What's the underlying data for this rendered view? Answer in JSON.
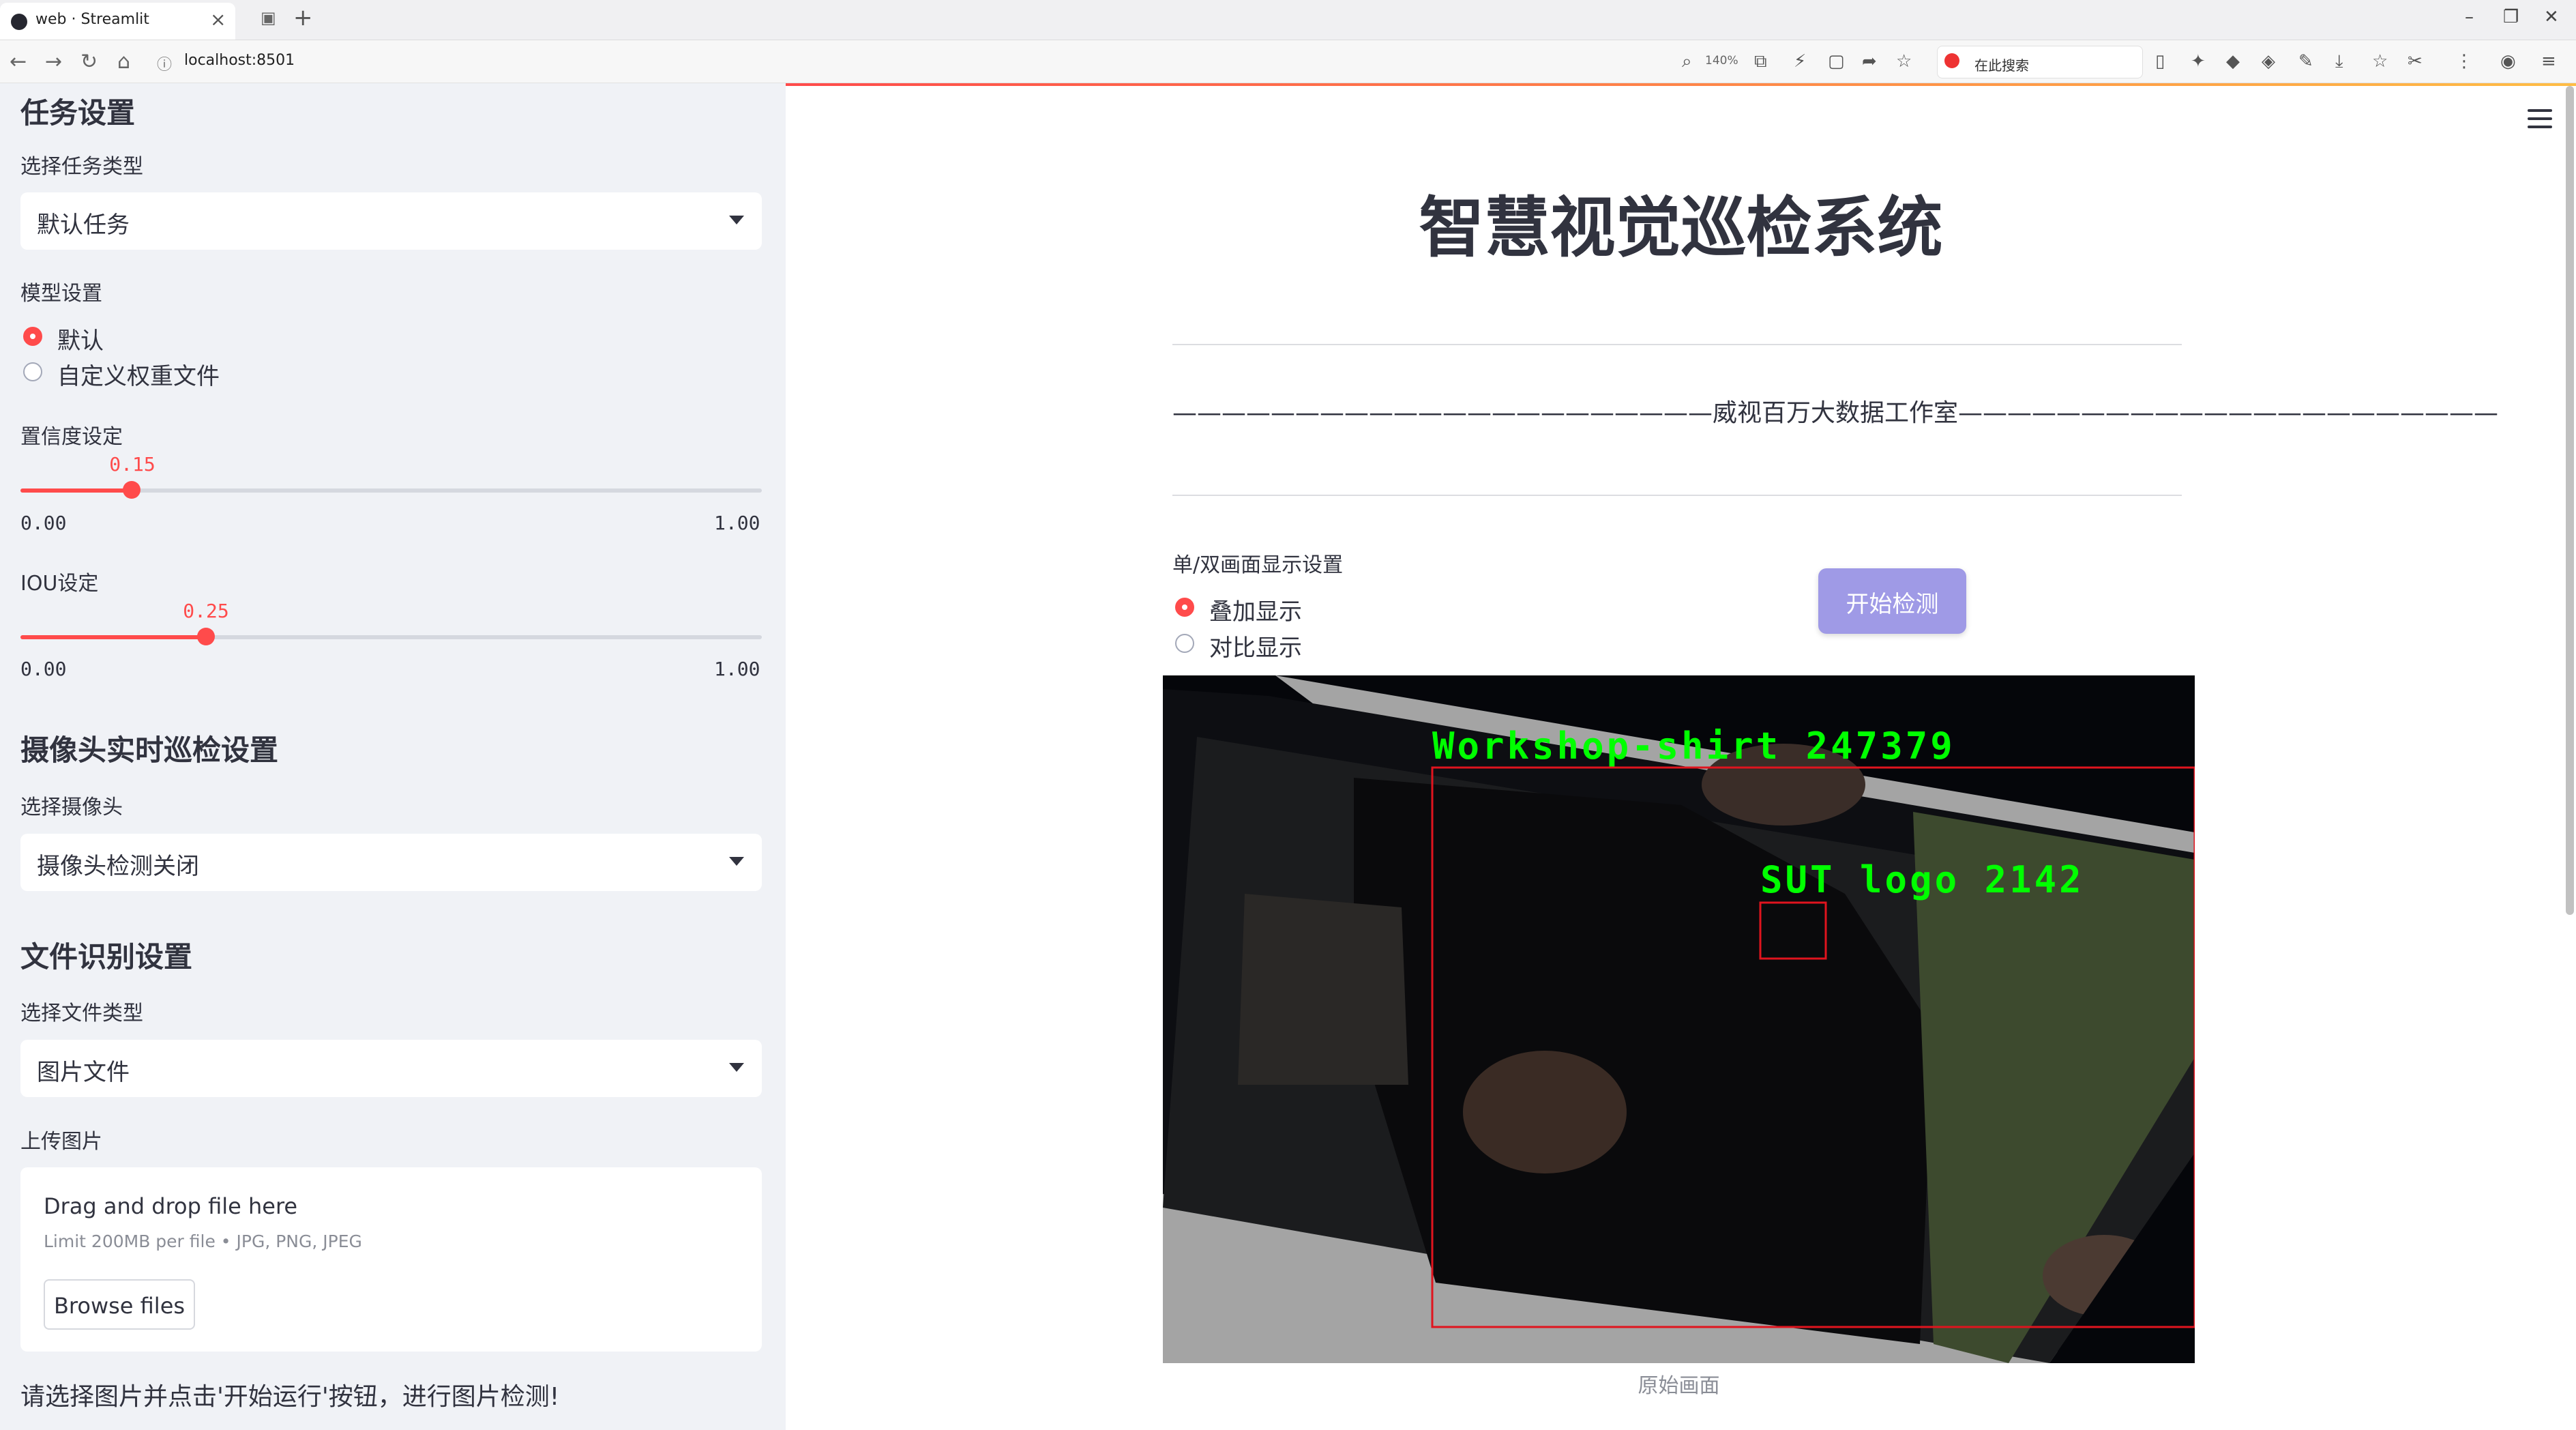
{
  "browser": {
    "tab_title": "web · Streamlit",
    "url": "localhost:8501",
    "zoom": "140%",
    "search_placeholder": "在此搜索"
  },
  "sidebar": {
    "task_section_title": "任务设置",
    "task_type_label": "选择任务类型",
    "task_type_value": "默认任务",
    "model_label": "模型设置",
    "model_options": [
      "默认",
      "自定义权重文件"
    ],
    "confidence_label": "置信度设定",
    "confidence": {
      "value": "0.15",
      "min": "0.00",
      "max": "1.00"
    },
    "iou_label": "IOU设定",
    "iou": {
      "value": "0.25",
      "min": "0.00",
      "max": "1.00"
    },
    "camera_section_title": "摄像头实时巡检设置",
    "camera_label": "选择摄像头",
    "camera_value": "摄像头检测关闭",
    "file_section_title": "文件识别设置",
    "file_type_label": "选择文件类型",
    "file_type_value": "图片文件",
    "upload_label": "上传图片",
    "uploader": {
      "title": "Drag and drop file here",
      "limit": "Limit 200MB per file • JPG, PNG, JPEG",
      "browse": "Browse files"
    },
    "hint": "请选择图片并点击'开始运行'按钮，进行图片检测!"
  },
  "main": {
    "title": "智慧视觉巡检系统",
    "subtitle": "——————————————————————威视百万大数据工作室——————————————————————",
    "display_label": "单/双画面显示设置",
    "display_options": [
      "叠加显示",
      "对比显示"
    ],
    "start_button": "开始检测",
    "detections": [
      {
        "label": "Workshop-shirt 247379"
      },
      {
        "label": "SUT logo 2142"
      }
    ],
    "caption": "原始画面"
  },
  "colors": {
    "accent": "#ff4b4b",
    "sidebar_bg": "#f0f2f6",
    "button": "#9f9ae6",
    "detection_text": "#00ff00",
    "detection_box": "#e0141e"
  }
}
